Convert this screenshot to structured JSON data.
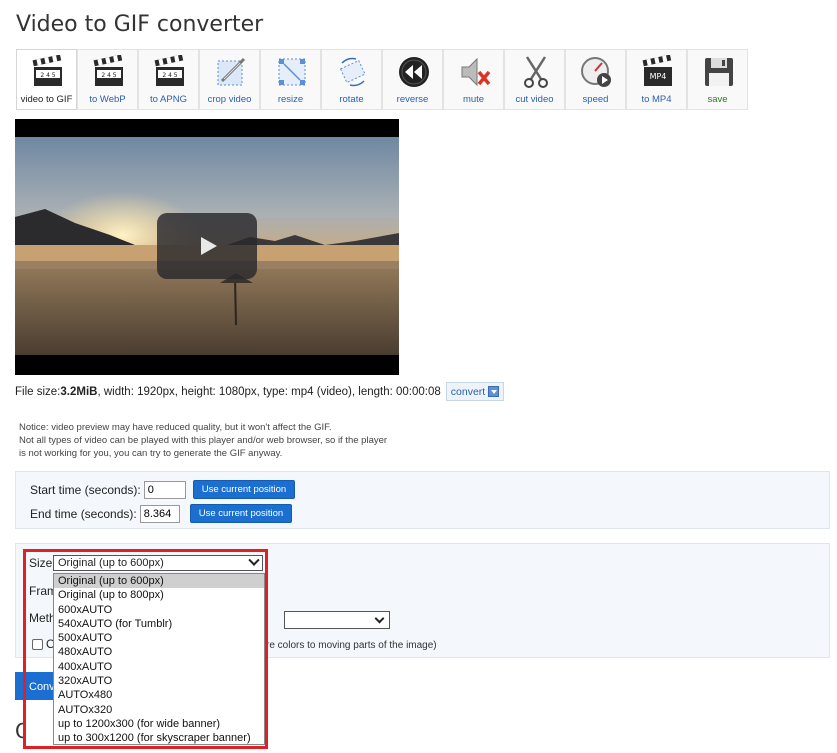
{
  "page": {
    "title": "Video to GIF converter"
  },
  "toolbar": [
    {
      "label": "video to GIF",
      "icon": "clapperboard-gif-icon"
    },
    {
      "label": "to WebP",
      "icon": "clapperboard-webp-icon"
    },
    {
      "label": "to APNG",
      "icon": "clapperboard-apng-icon"
    },
    {
      "label": "crop video",
      "icon": "crop-icon"
    },
    {
      "label": "resize",
      "icon": "resize-icon"
    },
    {
      "label": "rotate",
      "icon": "rotate-icon"
    },
    {
      "label": "reverse",
      "icon": "reverse-icon"
    },
    {
      "label": "mute",
      "icon": "mute-icon"
    },
    {
      "label": "cut video",
      "icon": "scissors-icon"
    },
    {
      "label": "speed",
      "icon": "speed-icon"
    },
    {
      "label": "to MP4",
      "icon": "mp4-icon"
    },
    {
      "label": "save",
      "icon": "floppy-disk-icon"
    }
  ],
  "toolbar_icon_text": {
    "clap_numbers": "2 4 5",
    "mp4": "MP4"
  },
  "fileinfo": {
    "prefix": "File size: ",
    "size": "3.2MiB",
    "rest": ", width: 1920px, height: 1080px, type: mp4 (video), length: 00:00:08",
    "convert_label": "convert"
  },
  "notice": [
    "Notice: video preview may have reduced quality, but it won't affect the GIF.",
    "Not all types of video can be played with this player and/or web browser, so if the player",
    "is not working for you, you can try to generate the GIF anyway."
  ],
  "time": {
    "start_label": "Start time (seconds):",
    "start_value": "0",
    "end_label": "End time (seconds):",
    "end_value": "8.364",
    "use_current_label": "Use current position"
  },
  "options": {
    "size_label": "Size:",
    "size_selected": "Original (up to 600px)",
    "frame_label_visible": "Fram",
    "method_label_visible": "Meth",
    "checkbox_text_visible": "O",
    "moving_parts_text": "re colors to moving parts of the image)",
    "size_options": [
      "Original (up to 600px)",
      "Original (up to 800px)",
      "600xAUTO",
      "540xAUTO (for Tumblr)",
      "500xAUTO",
      "480xAUTO",
      "400xAUTO",
      "320xAUTO",
      "AUTOx480",
      "AUTOx320",
      "up to 1200x300 (for wide banner)",
      "up to 300x1200 (for skyscraper banner)"
    ]
  },
  "convert_button_visible": "Conv",
  "output_title_visible": "Outp",
  "colors": {
    "accent": "#1b6fd1",
    "highlight": "#e01f26"
  }
}
